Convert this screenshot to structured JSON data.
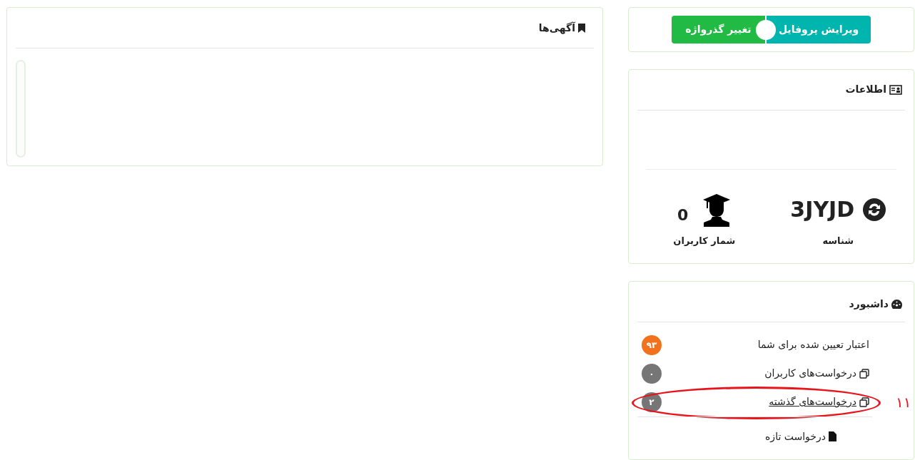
{
  "profile_buttons": [
    {
      "label": "ویرایش پروفایل",
      "color": "#00b5ad"
    },
    {
      "label": "تغییر گذرواژه",
      "color": "#21ba45"
    }
  ],
  "info": {
    "title": "اطلاعات",
    "id_value": "3JYJD",
    "id_label": "شناسه",
    "users_value": "0",
    "users_label": "شمار کاربران"
  },
  "dashboard": {
    "title": "داشبورد",
    "items": [
      {
        "kind": "plain",
        "label": "اعتبار تعیین شده برای شما",
        "badge": "۹۳",
        "color": "#f2711c",
        "underlined": false
      },
      {
        "kind": "copy",
        "label": "درخواست‌های کاربران",
        "badge": "۰",
        "color": "#767676",
        "underlined": false
      },
      {
        "kind": "copy",
        "label": "درخواست‌های گذشته",
        "badge": "۲",
        "color": "#767676",
        "underlined": true,
        "annotation": "۱۱"
      },
      {
        "kind": "file",
        "label": "درخواست تازه",
        "underlined": false
      }
    ]
  },
  "ads": {
    "title": "آگهی‌ها"
  }
}
